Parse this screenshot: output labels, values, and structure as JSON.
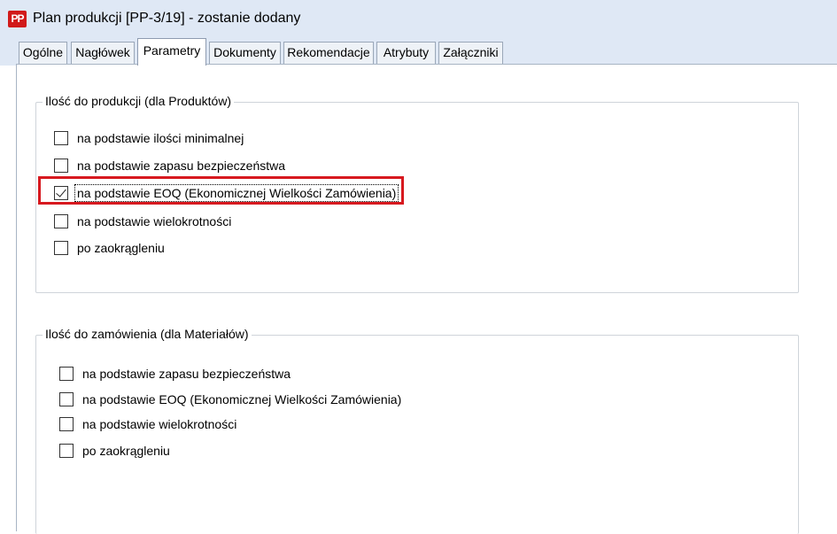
{
  "window": {
    "title": "Plan produkcji [PP-3/19] - zostanie dodany",
    "icon": "plan-produkcji-app-icon",
    "icon_text": "PP"
  },
  "tabs": [
    {
      "label": "Ogólne"
    },
    {
      "label": "Nagłówek"
    },
    {
      "label": "Parametry",
      "active": true
    },
    {
      "label": "Dokumenty"
    },
    {
      "label": "Rekomendacje"
    },
    {
      "label": "Atrybuty"
    },
    {
      "label": "Załączniki"
    }
  ],
  "group_products": {
    "title": "Ilość do produkcji (dla Produktów)",
    "options": [
      {
        "label": "na podstawie ilości minimalnej",
        "checked": false
      },
      {
        "label": "na podstawie zapasu bezpieczeństwa",
        "checked": false
      },
      {
        "label": "na podstawie EOQ (Ekonomicznej Wielkości Zamówienia)",
        "checked": true,
        "highlighted": true
      },
      {
        "label": "na podstawie wielokrotności",
        "checked": false
      },
      {
        "label": "po zaokrągleniu",
        "checked": false
      }
    ]
  },
  "group_materials": {
    "title": "Ilość do zamówienia (dla Materiałów)",
    "options": [
      {
        "label": "na podstawie zapasu bezpieczeństwa",
        "checked": false
      },
      {
        "label": "na podstawie EOQ (Ekonomicznej Wielkości Zamówienia)",
        "checked": false
      },
      {
        "label": "na podstawie wielokrotności",
        "checked": false
      },
      {
        "label": "po zaokrągleniu",
        "checked": false
      }
    ]
  },
  "colors": {
    "titlebar": "#dfe8f5",
    "highlight": "#d7191f",
    "app_icon": "#d11a1a"
  }
}
